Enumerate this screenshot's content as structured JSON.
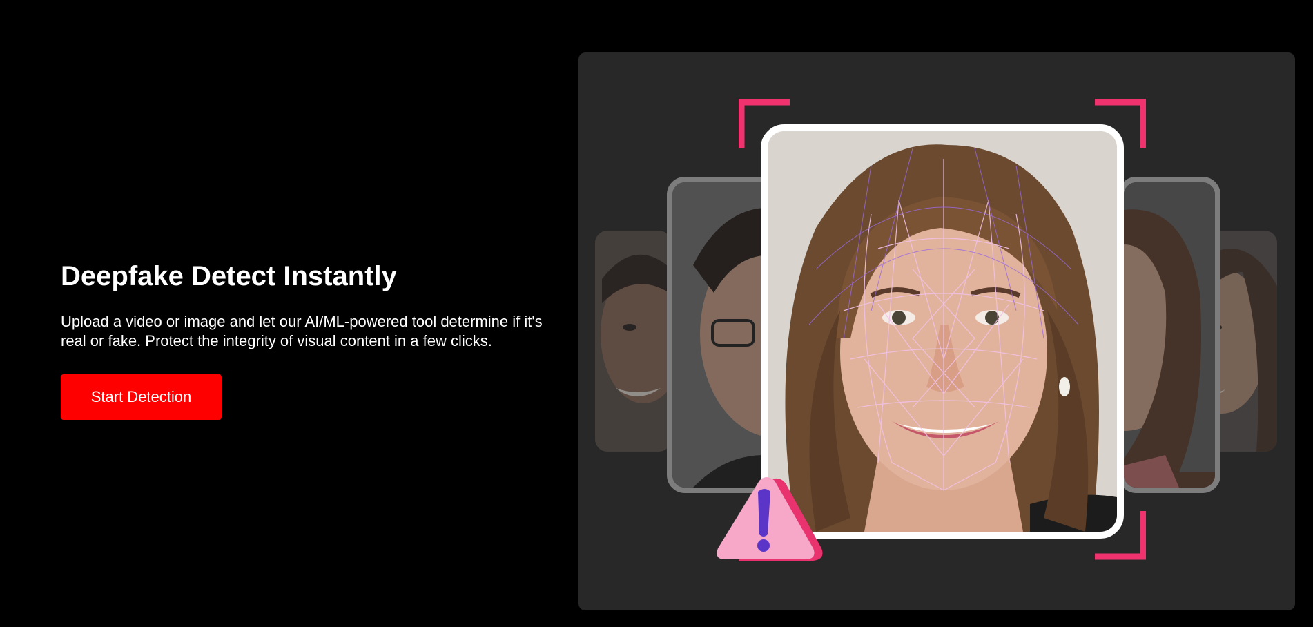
{
  "hero": {
    "title": "Deepfake Detect Instantly",
    "description": "Upload a video or image and let our AI/ML-powered tool determine if it's real or fake. Protect the integrity of visual content in a few clicks.",
    "cta_label": "Start Detection"
  },
  "colors": {
    "background": "#000000",
    "panel": "#282828",
    "cta": "#ff0000",
    "bracket": "#f0336f",
    "mesh": "#c77df0",
    "warning": "#f7a8c8",
    "warning_mark": "#5a35c8"
  },
  "visual": {
    "icons": [
      "face-scan-brackets",
      "face-mesh-overlay",
      "warning-icon"
    ]
  }
}
